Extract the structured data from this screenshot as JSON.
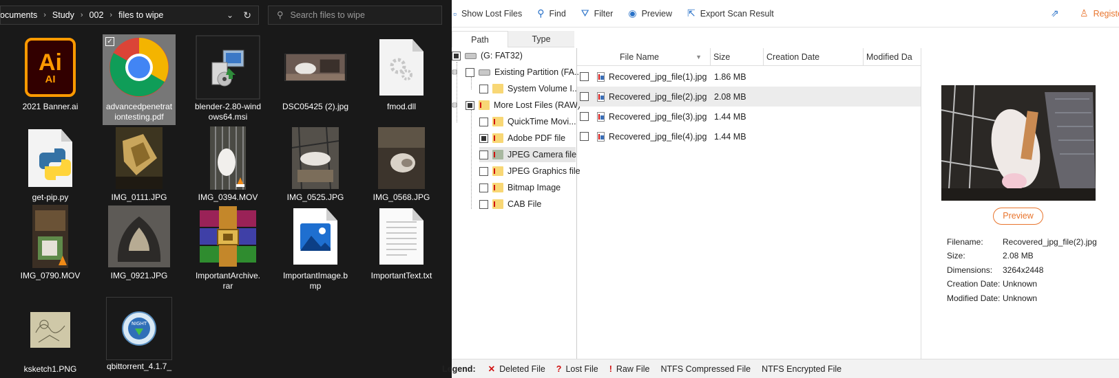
{
  "explorer": {
    "breadcrumbs": [
      "Documents",
      "Study",
      "002",
      "files to wipe"
    ],
    "search_placeholder": "Search files to wipe",
    "files": [
      {
        "name": "2021 Banner.ai",
        "icon": "illustrator-icon"
      },
      {
        "name": "advancedpenetrationtesting.pdf",
        "icon": "chrome-icon",
        "selected": true
      },
      {
        "name": "blender-2.80-windows64.msi",
        "icon": "installer-icon"
      },
      {
        "name": "DSC05425 (2).jpg",
        "icon": "photo-thumbnail"
      },
      {
        "name": "fmod.dll",
        "icon": "dll-icon"
      },
      {
        "name": "get-pip.py",
        "icon": "python-icon"
      },
      {
        "name": "IMG_0111.JPG",
        "icon": "photo-thumbnail"
      },
      {
        "name": "IMG_0394.MOV",
        "icon": "video-thumbnail"
      },
      {
        "name": "IMG_0525.JPG",
        "icon": "photo-thumbnail"
      },
      {
        "name": "IMG_0568.JPG",
        "icon": "photo-thumbnail"
      },
      {
        "name": "IMG_0790.MOV",
        "icon": "video-thumbnail"
      },
      {
        "name": "IMG_0921.JPG",
        "icon": "photo-thumbnail"
      },
      {
        "name": "ImportantArchive.rar",
        "icon": "winrar-icon"
      },
      {
        "name": "ImportantImage.bmp",
        "icon": "image-file-icon"
      },
      {
        "name": "ImportantText.txt",
        "icon": "text-file-icon"
      },
      {
        "name": "ksketch1.PNG",
        "icon": "sketch-thumbnail"
      },
      {
        "name": "qbittorrent_4.1.7_",
        "icon": "qbittorrent-icon"
      }
    ]
  },
  "toolbar": {
    "show_lost_files": "Show Lost Files",
    "find": "Find",
    "filter": "Filter",
    "preview": "Preview",
    "export": "Export Scan Result",
    "register": "Registe"
  },
  "tabs": {
    "path": "Path",
    "type": "Type"
  },
  "tree": {
    "root": "(G: FAT32)",
    "existing_partition": "Existing Partition (FA...",
    "system_volume": "System Volume I...",
    "more_lost_files": "More Lost Files (RAW)",
    "children": [
      "QuickTime Movi...",
      "Adobe PDF file",
      "JPEG Camera file",
      "JPEG Graphics file",
      "Bitmap Image",
      "CAB File"
    ]
  },
  "file_list": {
    "headers": {
      "name": "File Name",
      "size": "Size",
      "created": "Creation Date",
      "modified": "Modified Da"
    },
    "rows": [
      {
        "name": "Recovered_jpg_file(1).jpg",
        "size": "1.86 MB"
      },
      {
        "name": "Recovered_jpg_file(2).jpg",
        "size": "2.08 MB",
        "selected": true
      },
      {
        "name": "Recovered_jpg_file(3).jpg",
        "size": "1.44 MB"
      },
      {
        "name": "Recovered_jpg_file(4).jpg",
        "size": "1.44 MB"
      }
    ]
  },
  "preview_panel": {
    "button": "Preview",
    "filename_label": "Filename:",
    "filename": "Recovered_jpg_file(2).jpg",
    "size_label": "Size:",
    "size": "2.08 MB",
    "dimensions_label": "Dimensions:",
    "dimensions": "3264x2448",
    "created_label": "Creation Date:",
    "created": "Unknown",
    "modified_label": "Modified Date:",
    "modified": "Unknown"
  },
  "legend": {
    "label": "Legend:",
    "items": [
      {
        "mark": "✕",
        "text": "Deleted File"
      },
      {
        "mark": "?",
        "text": "Lost File"
      },
      {
        "mark": "!",
        "text": "Raw File"
      },
      {
        "mark": "",
        "text": "NTFS Compressed File"
      },
      {
        "mark": "",
        "text": "NTFS Encrypted File"
      }
    ]
  },
  "colors": {
    "accent_orange": "#e8742c",
    "toolbar_blue": "#2a72c8",
    "explorer_bg": "#191919",
    "selected_item": "#777777"
  }
}
